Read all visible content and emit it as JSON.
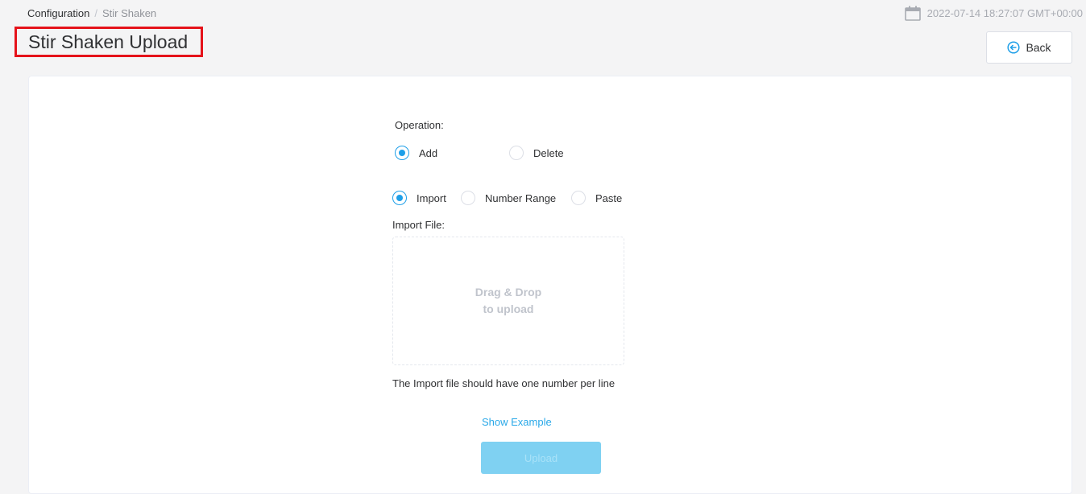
{
  "breadcrumb": {
    "root": "Configuration",
    "separator": "/",
    "current": "Stir Shaken"
  },
  "datetime": "2022-07-14 18:27:07 GMT+00:00",
  "page_title": "Stir Shaken Upload",
  "back_button": {
    "label": "Back",
    "icon": "circle-arrow-left-icon"
  },
  "operation": {
    "label": "Operation:",
    "options": [
      {
        "label": "Add",
        "checked": true
      },
      {
        "label": "Delete",
        "checked": false
      }
    ]
  },
  "source": {
    "options": [
      {
        "label": "Import",
        "checked": true
      },
      {
        "label": "Number Range",
        "checked": false
      },
      {
        "label": "Paste",
        "checked": false
      }
    ]
  },
  "import_file": {
    "label": "Import File:",
    "dropzone_line1": "Drag & Drop",
    "dropzone_line2": "to upload",
    "hint": "The Import file should have one number per line",
    "show_example": "Show Example"
  },
  "upload_button": {
    "label": "Upload",
    "disabled": true
  },
  "colors": {
    "accent": "#1e9fe8",
    "link": "#29a8e8",
    "title_highlight_border": "#e5121a",
    "upload_disabled": "#7fd1f2"
  }
}
